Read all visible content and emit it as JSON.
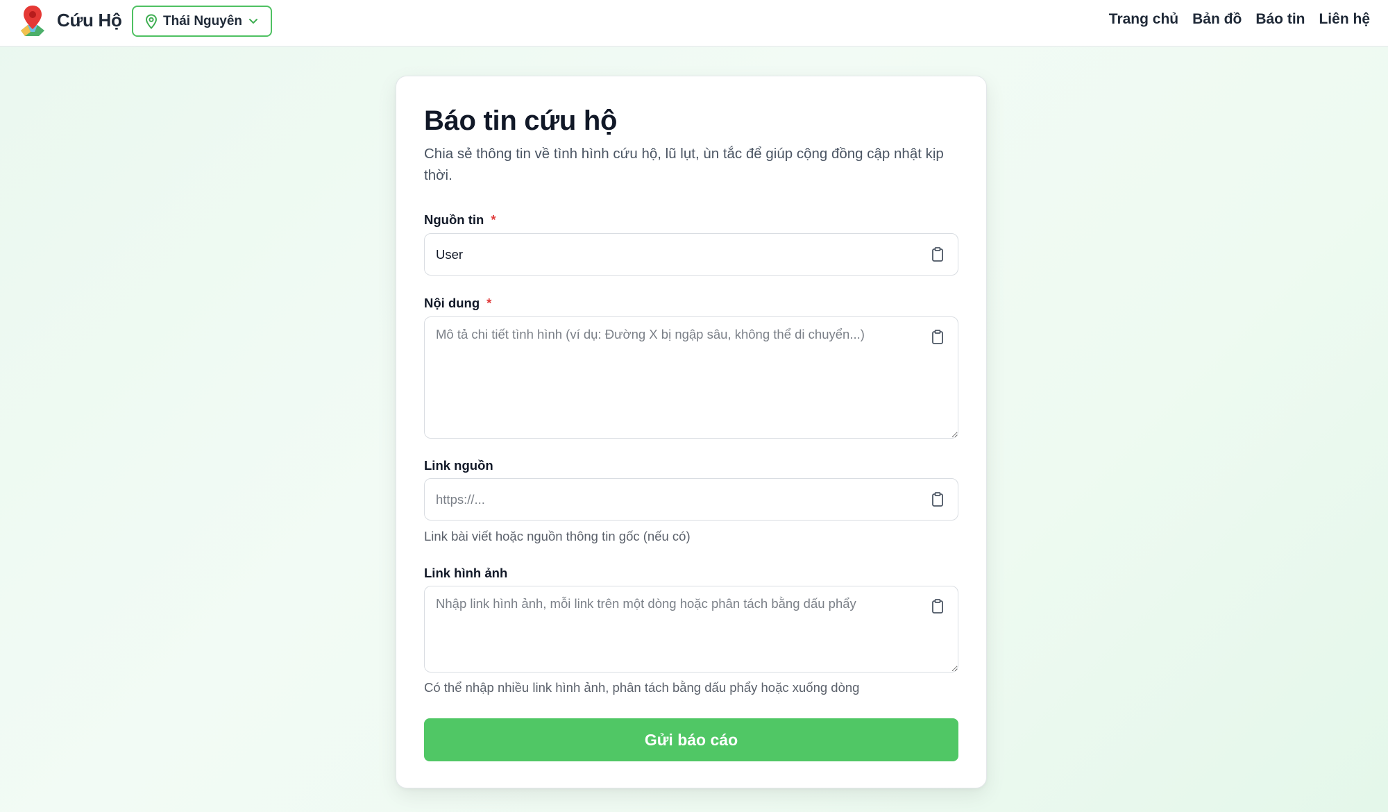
{
  "header": {
    "brand": "Cứu Hộ",
    "location": "Thái Nguyên",
    "nav": [
      "Trang chủ",
      "Bản đồ",
      "Báo tin",
      "Liên hệ"
    ]
  },
  "form": {
    "title": "Báo tin cứu hộ",
    "subtitle": "Chia sẻ thông tin về tình hình cứu hộ, lũ lụt, ùn tắc để giúp cộng đồng cập nhật kịp thời.",
    "source": {
      "label": "Nguồn tin",
      "required_mark": "*",
      "value": "User"
    },
    "content": {
      "label": "Nội dung",
      "required_mark": "*",
      "placeholder": "Mô tả chi tiết tình hình (ví dụ: Đường X bị ngập sâu, không thể di chuyển...)"
    },
    "link_source": {
      "label": "Link nguồn",
      "placeholder": "https://...",
      "hint": "Link bài viết hoặc nguồn thông tin gốc (nếu có)"
    },
    "image_links": {
      "label": "Link hình ảnh",
      "placeholder": "Nhập link hình ảnh, mỗi link trên một dòng hoặc phân tách bằng dấu phẩy",
      "hint": "Có thể nhập nhiều link hình ảnh, phân tách bằng dấu phẩy hoặc xuống dòng"
    },
    "submit_label": "Gửi báo cáo"
  },
  "icons": {
    "logo": "map-pin-logo-icon",
    "location": "map-pin-icon",
    "dropdown": "chevron-down-icon",
    "paste": "clipboard-icon"
  },
  "colors": {
    "accent": "#50c765",
    "required": "#e03a3a"
  }
}
